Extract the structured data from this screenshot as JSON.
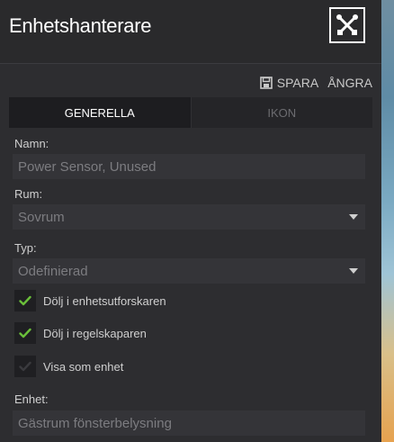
{
  "header": {
    "title": "Enhetshanterare",
    "tools_icon": "tools-cross-icon"
  },
  "actions": {
    "save_label": "SPARA",
    "undo_label": "ÅNGRA",
    "save_icon": "floppy-disk-icon"
  },
  "tabs": [
    {
      "label": "GENERELLA",
      "active": true
    },
    {
      "label": "IKON",
      "active": false
    }
  ],
  "form": {
    "name": {
      "label": "Namn:",
      "placeholder": "Power Sensor, Unused"
    },
    "room": {
      "label": "Rum:",
      "value": "Sovrum"
    },
    "type": {
      "label": "Typ:",
      "value": "Odefinierad"
    },
    "checks": [
      {
        "label": "Dölj i enhetsutforskaren",
        "checked": true
      },
      {
        "label": "Dölj i regelskaparen",
        "checked": true
      },
      {
        "label": "Visa som enhet",
        "checked": false
      }
    ],
    "unit": {
      "label": "Enhet:",
      "value": "Gästrum fönsterbelysning"
    }
  },
  "colors": {
    "check_green": "#6abf3a",
    "panel": "#2d2d30",
    "field": "#343438"
  }
}
